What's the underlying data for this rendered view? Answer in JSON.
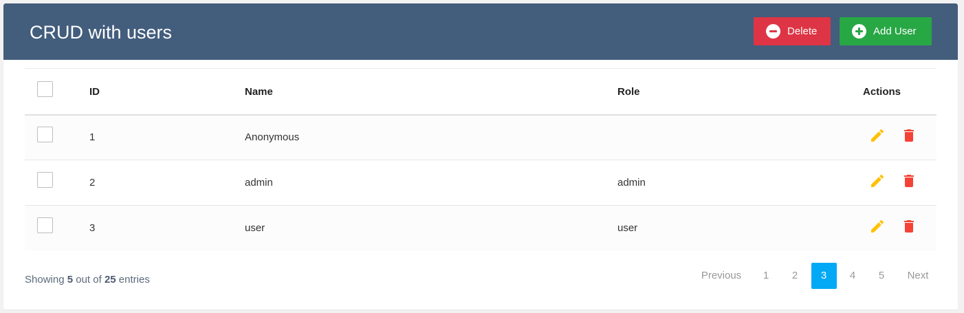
{
  "header": {
    "title": "CRUD with users",
    "delete_label": "Delete",
    "add_label": "Add User"
  },
  "table": {
    "columns": [
      "ID",
      "Name",
      "Role",
      "Actions"
    ],
    "rows": [
      {
        "id": "1",
        "name": "Anonymous",
        "role": ""
      },
      {
        "id": "2",
        "name": "admin",
        "role": "admin"
      },
      {
        "id": "3",
        "name": "user",
        "role": "user"
      }
    ]
  },
  "footer": {
    "showing_prefix": "Showing",
    "shown_count": "5",
    "out_of_text": "out of",
    "total_count": "25",
    "entries_text": "entries"
  },
  "pagination": {
    "previous": "Previous",
    "pages": [
      "1",
      "2",
      "3",
      "4",
      "5"
    ],
    "active_page": "3",
    "next": "Next"
  },
  "colors": {
    "header_bg": "#435d7d",
    "delete_button": "#dd3545",
    "add_button": "#28a745",
    "edit_icon": "#ffc107",
    "delete_icon": "#f44336",
    "active_page": "#03a9f4"
  },
  "icons": {
    "delete_button": "minus-circle-icon",
    "add_button": "plus-circle-icon",
    "row_edit": "pencil-icon",
    "row_delete": "trash-icon"
  }
}
